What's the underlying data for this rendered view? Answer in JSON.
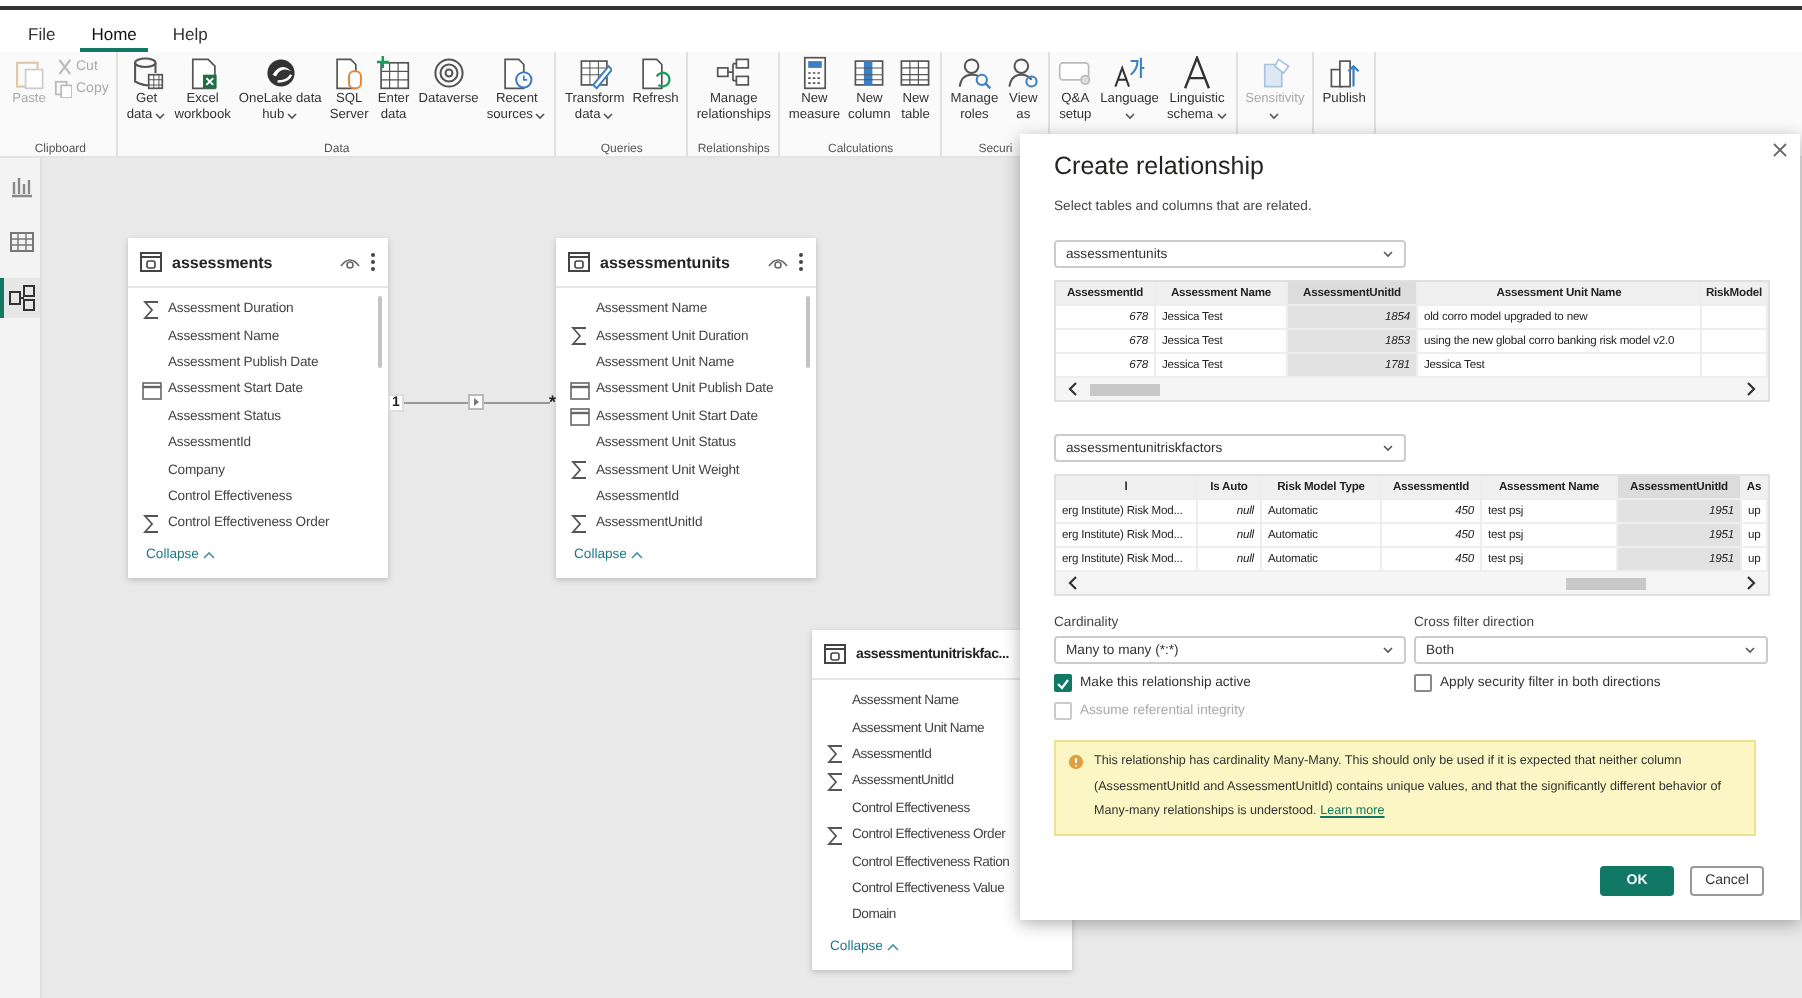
{
  "menu_tabs": [
    {
      "label": "File",
      "selected": false
    },
    {
      "label": "Home",
      "selected": true
    },
    {
      "label": "Help",
      "selected": false
    }
  ],
  "ribbon": [
    {
      "label": "Clipboard",
      "buttons": [
        {
          "kind": "large",
          "lines": [
            "Paste"
          ],
          "disabled": true
        },
        {
          "kind": "small",
          "lines": [
            "Cut"
          ],
          "disabled": true
        },
        {
          "kind": "small",
          "lines": [
            "Copy"
          ],
          "disabled": true
        }
      ]
    },
    {
      "label": "Data",
      "buttons": [
        {
          "kind": "large",
          "lines": [
            "Get",
            "data"
          ],
          "dropdown": true,
          "disabled": false
        },
        {
          "kind": "large",
          "lines": [
            "Excel",
            "workbook"
          ],
          "disabled": false
        },
        {
          "kind": "large",
          "lines": [
            "OneLake data",
            "hub"
          ],
          "dropdown": true,
          "disabled": false
        },
        {
          "kind": "large",
          "lines": [
            "SQL",
            "Server"
          ],
          "disabled": false
        },
        {
          "kind": "large",
          "lines": [
            "Enter",
            "data"
          ],
          "disabled": false
        },
        {
          "kind": "large",
          "lines": [
            "Dataverse"
          ],
          "disabled": false
        },
        {
          "kind": "large",
          "lines": [
            "Recent",
            "sources"
          ],
          "dropdown": true,
          "disabled": false
        }
      ]
    },
    {
      "label": "Queries",
      "buttons": [
        {
          "kind": "large",
          "lines": [
            "Transform",
            "data"
          ],
          "dropdown": true,
          "disabled": false
        },
        {
          "kind": "large",
          "lines": [
            "Refresh"
          ],
          "disabled": false
        }
      ]
    },
    {
      "label": "Relationships",
      "buttons": [
        {
          "kind": "large",
          "lines": [
            "Manage",
            "relationships"
          ],
          "disabled": false
        }
      ]
    },
    {
      "label": "Calculations",
      "buttons": [
        {
          "kind": "large",
          "lines": [
            "New",
            "measure"
          ],
          "disabled": false
        },
        {
          "kind": "large",
          "lines": [
            "New",
            "column"
          ],
          "disabled": false
        },
        {
          "kind": "large",
          "lines": [
            "New",
            "table"
          ],
          "disabled": false
        }
      ]
    },
    {
      "label": "Securi",
      "buttons": [
        {
          "kind": "large",
          "lines": [
            "Manage",
            "roles"
          ],
          "disabled": false
        },
        {
          "kind": "large",
          "lines": [
            "View",
            "as"
          ],
          "disabled": false
        }
      ]
    },
    {
      "buttons": [
        {
          "kind": "large",
          "lines": [
            "Q&A",
            "setup"
          ],
          "disabled": false
        },
        {
          "kind": "large",
          "lines": [
            "Language"
          ],
          "dropdown": true,
          "disabled": false
        },
        {
          "kind": "large",
          "lines": [
            "Linguistic",
            "schema"
          ],
          "dropdown": true,
          "disabled": false
        }
      ]
    },
    {
      "buttons": [
        {
          "kind": "large",
          "lines": [
            "Sensitivity"
          ],
          "dropdown": true,
          "disabled": true
        }
      ]
    },
    {
      "buttons": [
        {
          "kind": "large",
          "lines": [
            "Publish"
          ],
          "disabled": false
        }
      ]
    }
  ],
  "rail": [
    {
      "selected": false
    },
    {
      "selected": false
    },
    {
      "selected": true
    }
  ],
  "cards": [
    {
      "title": "assessments",
      "collapse": "Collapse",
      "fields": [
        {
          "kind": "sum",
          "name": "Assessment Duration"
        },
        {
          "kind": "text",
          "name": "Assessment Name"
        },
        {
          "kind": "text",
          "name": "Assessment Publish Date"
        },
        {
          "kind": "date",
          "name": "Assessment Start Date"
        },
        {
          "kind": "text",
          "name": "Assessment Status"
        },
        {
          "kind": "text",
          "name": "AssessmentId"
        },
        {
          "kind": "text",
          "name": "Company"
        },
        {
          "kind": "text",
          "name": "Control Effectiveness"
        },
        {
          "kind": "sum",
          "name": "Control Effectiveness Order"
        }
      ]
    },
    {
      "title": "assessmentunits",
      "collapse": "Collapse",
      "fields": [
        {
          "kind": "text",
          "name": "Assessment Name"
        },
        {
          "kind": "sum",
          "name": "Assessment Unit Duration"
        },
        {
          "kind": "text",
          "name": "Assessment Unit Name"
        },
        {
          "kind": "date",
          "name": "Assessment Unit Publish Date"
        },
        {
          "kind": "date",
          "name": "Assessment Unit Start Date"
        },
        {
          "kind": "text",
          "name": "Assessment Unit Status"
        },
        {
          "kind": "sum",
          "name": "Assessment Unit Weight"
        },
        {
          "kind": "text",
          "name": "AssessmentId"
        },
        {
          "kind": "sum",
          "name": "AssessmentUnitId"
        }
      ]
    },
    {
      "title": "assessmentunitriskfac...",
      "collapse": "Collapse",
      "fields": [
        {
          "kind": "text",
          "name": "Assessment Name"
        },
        {
          "kind": "text",
          "name": "Assessment Unit Name"
        },
        {
          "kind": "sum",
          "name": "AssessmentId"
        },
        {
          "kind": "sum",
          "name": "AssessmentUnitId"
        },
        {
          "kind": "text",
          "name": "Control Effectiveness"
        },
        {
          "kind": "sum",
          "name": "Control Effectiveness Order"
        },
        {
          "kind": "text",
          "name": "Control Effectiveness Ration"
        },
        {
          "kind": "text",
          "name": "Control Effectiveness Value"
        },
        {
          "kind": "text",
          "name": "Domain"
        }
      ]
    }
  ],
  "relationship": {
    "from_label": "1",
    "to_label": "*"
  },
  "dialog": {
    "title": "Create relationship",
    "subtitle": "Select tables and columns that are related.",
    "tables": [
      {
        "select": "assessmentunits",
        "columns": [
          {
            "label": "AssessmentId",
            "kind": "number",
            "selected": false
          },
          {
            "label": "Assessment Name",
            "kind": "text",
            "selected": false
          },
          {
            "label": "AssessmentUnitId",
            "kind": "number",
            "selected": true
          },
          {
            "label": "Assessment Unit Name",
            "kind": "text",
            "selected": false
          },
          {
            "label": "RiskModel",
            "kind": "text",
            "selected": false
          }
        ],
        "rows": [
          [
            "678",
            "Jessica Test",
            "1854",
            "old corro model upgraded to new"
          ],
          [
            "678",
            "Jessica Test",
            "1853",
            "using the new global corro banking risk model v2.0"
          ],
          [
            "678",
            "Jessica Test",
            "1781",
            "Jessica Test"
          ]
        ]
      },
      {
        "select": "assessmentunitriskfactors",
        "columns": [
          {
            "label": "l",
            "kind": "text",
            "selected": false
          },
          {
            "label": "Is Auto",
            "kind": "number",
            "selected": false
          },
          {
            "label": "Risk Model Type",
            "kind": "text",
            "selected": false
          },
          {
            "label": "AssessmentId",
            "kind": "number",
            "selected": false
          },
          {
            "label": "Assessment Name",
            "kind": "text",
            "selected": false
          },
          {
            "label": "AssessmentUnitId",
            "kind": "number",
            "selected": true
          },
          {
            "label": "As",
            "kind": "text",
            "selected": false
          }
        ],
        "rows": [
          [
            "erg Institute) Risk Mod...",
            "null",
            "Automatic",
            "450",
            "test psj",
            "1951",
            "up"
          ],
          [
            "erg Institute) Risk Mod...",
            "null",
            "Automatic",
            "450",
            "test psj",
            "1951",
            "up"
          ],
          [
            "erg Institute) Risk Mod...",
            "null",
            "Automatic",
            "450",
            "test psj",
            "1951",
            "up"
          ]
        ]
      }
    ],
    "cardinality": {
      "label": "Cardinality",
      "value": "Many to many (*:*)"
    },
    "cross_filter": {
      "label": "Cross filter direction",
      "value": "Both"
    },
    "checkboxes": [
      {
        "label": "Make this relationship active",
        "checked": true,
        "disabled": false
      },
      {
        "label": "Apply security filter in both directions",
        "checked": false,
        "disabled": false
      },
      {
        "label": "Assume referential integrity",
        "checked": false,
        "disabled": true
      }
    ],
    "warning": {
      "text": "This relationship has cardinality Many-Many. This should only be used if it is expected that neither column (AssessmentUnitId and AssessmentUnitId) contains unique values, and that the significantly different behavior of Many-many relationships is understood.",
      "link": "Learn more"
    },
    "buttons": [
      {
        "label": "OK",
        "kind": "primary"
      },
      {
        "label": "Cancel",
        "kind": "secondary"
      }
    ]
  }
}
